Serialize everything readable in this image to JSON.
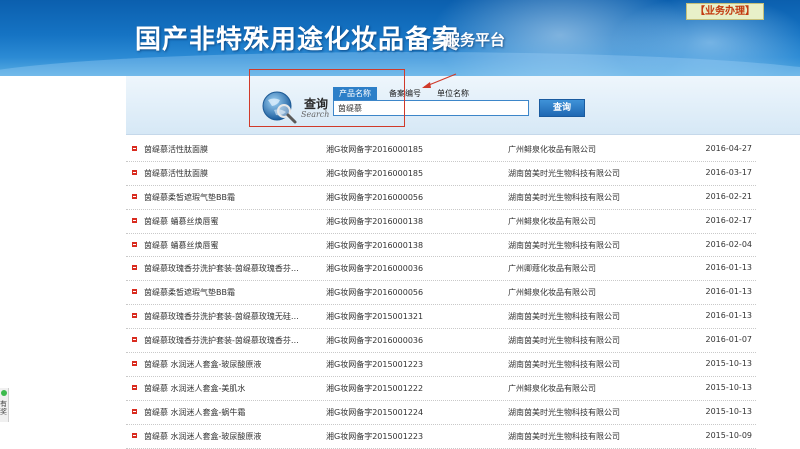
{
  "header": {
    "title": "国产非特殊用途化妆品备案",
    "subtitle": "服务平台",
    "service_link": "【业务办理】"
  },
  "search": {
    "logo_cn": "查询",
    "logo_en": "Search",
    "tabs": [
      {
        "label": "产品名称",
        "active": true
      },
      {
        "label": "备案编号",
        "active": false
      },
      {
        "label": "单位名称",
        "active": false
      }
    ],
    "input_value": "茵缇慕",
    "button_label": "查询"
  },
  "results": [
    {
      "name": "茵缇慕活性肽面膜",
      "reg": "湘G妆网备字2016000185",
      "company": "广州鲱泉化妆品有限公司",
      "date": "2016-04-27"
    },
    {
      "name": "茵缇慕活性肽面膜",
      "reg": "湘G妆网备字2016000185",
      "company": "湖南茵美时光生物科技有限公司",
      "date": "2016-03-17"
    },
    {
      "name": "茵缇慕柔皙遮瑕气垫BB霜",
      "reg": "湘G妆网备字2016000056",
      "company": "湖南茵美时光生物科技有限公司",
      "date": "2016-02-21"
    },
    {
      "name": "茵缇慕 蛹慕丝焕唇蜜",
      "reg": "湘G妆网备字2016000138",
      "company": "广州鲱泉化妆品有限公司",
      "date": "2016-02-17"
    },
    {
      "name": "茵缇慕 蛹慕丝焕唇蜜",
      "reg": "湘G妆网备字2016000138",
      "company": "湖南茵美时光生物科技有限公司",
      "date": "2016-02-04"
    },
    {
      "name": "茵缇慕玫瑰香芬洗护套装-茵缇慕玫瑰香芬…",
      "reg": "湘G妆网备字2016000036",
      "company": "广州卿蔻化妆品有限公司",
      "date": "2016-01-13"
    },
    {
      "name": "茵缇慕柔皙遮瑕气垫BB霜",
      "reg": "湘G妆网备字2016000056",
      "company": "广州鲱泉化妆品有限公司",
      "date": "2016-01-13"
    },
    {
      "name": "茵缇慕玫瑰香芬洗护套装-茵缇慕玫瑰无硅…",
      "reg": "湘G妆网备字2015001321",
      "company": "湖南茵美时光生物科技有限公司",
      "date": "2016-01-13"
    },
    {
      "name": "茵缇慕玫瑰香芬洗护套装-茵缇慕玫瑰香芬…",
      "reg": "湘G妆网备字2016000036",
      "company": "湖南茵美时光生物科技有限公司",
      "date": "2016-01-07"
    },
    {
      "name": "茵缇慕 水润迷人套盒-玻尿酸原液",
      "reg": "湘G妆网备字2015001223",
      "company": "湖南茵美时光生物科技有限公司",
      "date": "2015-10-13"
    },
    {
      "name": "茵缇慕 水润迷人套盒-美肌水",
      "reg": "湘G妆网备字2015001222",
      "company": "广州鲱泉化妆品有限公司",
      "date": "2015-10-13"
    },
    {
      "name": "茵缇慕 水润迷人套盒-蜗牛霜",
      "reg": "湘G妆网备字2015001224",
      "company": "湖南茵美时光生物科技有限公司",
      "date": "2015-10-13"
    },
    {
      "name": "茵缇慕 水润迷人套盒-玻尿酸原液",
      "reg": "湘G妆网备字2015001223",
      "company": "湖南茵美时光生物科技有限公司",
      "date": "2015-10-09"
    }
  ],
  "side_widget": {
    "text": "有奖"
  },
  "colors": {
    "banner": "#1573c3",
    "tab_active": "#2d7fc8",
    "bullet": "#d92b1f",
    "annotation": "#d03a2a"
  }
}
